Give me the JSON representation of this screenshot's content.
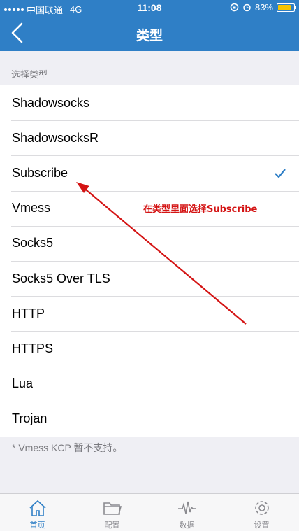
{
  "status_bar": {
    "carrier": "中国联通",
    "network": "4G",
    "time": "11:08",
    "battery": "83%",
    "battery_level": 0.83
  },
  "nav": {
    "title": "类型"
  },
  "section_header": "选择类型",
  "types": [
    {
      "label": "Shadowsocks",
      "selected": false
    },
    {
      "label": "ShadowsocksR",
      "selected": false
    },
    {
      "label": "Subscribe",
      "selected": true
    },
    {
      "label": "Vmess",
      "selected": false
    },
    {
      "label": "Socks5",
      "selected": false
    },
    {
      "label": "Socks5 Over TLS",
      "selected": false
    },
    {
      "label": "HTTP",
      "selected": false
    },
    {
      "label": "HTTPS",
      "selected": false
    },
    {
      "label": "Lua",
      "selected": false
    },
    {
      "label": "Trojan",
      "selected": false
    }
  ],
  "footnote": "* Vmess KCP 暂不支持。",
  "annotation": "在类型里面选择Subscribe",
  "tabs": [
    {
      "label": "首页",
      "icon": "home-icon",
      "active": true
    },
    {
      "label": "配置",
      "icon": "folder-icon",
      "active": false
    },
    {
      "label": "数据",
      "icon": "waveform-icon",
      "active": false
    },
    {
      "label": "设置",
      "icon": "gear-icon",
      "active": false
    }
  ],
  "colors": {
    "accent": "#2f7fc6",
    "annotation": "#d41414"
  }
}
